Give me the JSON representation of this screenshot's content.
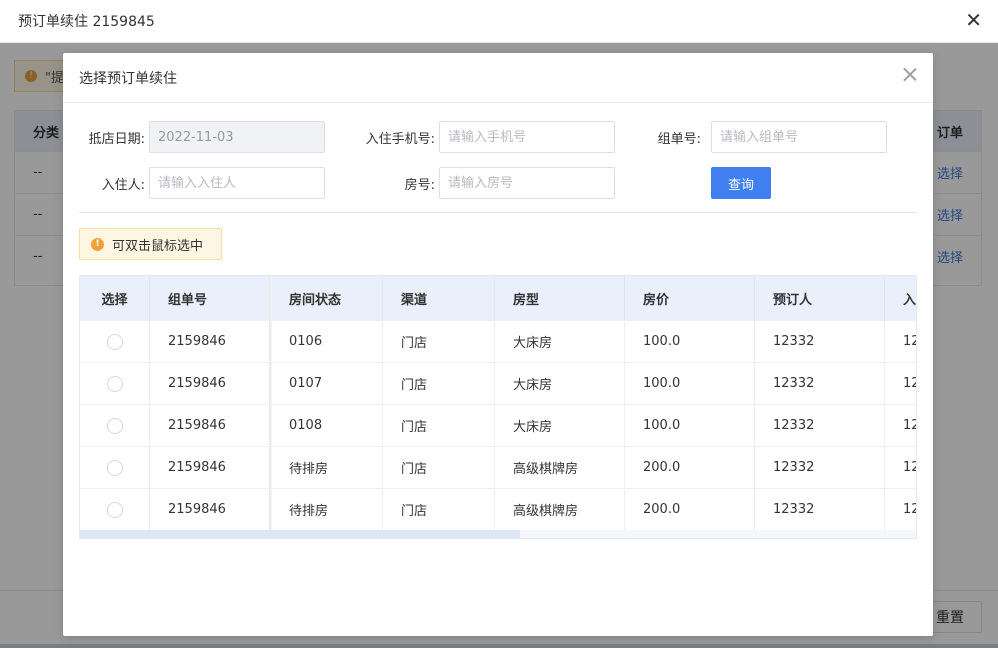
{
  "background": {
    "title": "预订单续住 2159845",
    "close_glyph": "✕",
    "alert_text": "\"提",
    "table_header_left": "分类",
    "table_header_right": "订单",
    "rows": [
      {
        "left": "--",
        "action": "选择"
      },
      {
        "left": "--",
        "action": "选择"
      },
      {
        "left": "--",
        "action": "选择"
      }
    ],
    "reset_label": "重置"
  },
  "modal": {
    "title": "选择预订单续住",
    "form": {
      "arrival_date_label": "抵店日期:",
      "arrival_date_value": "2022-11-03",
      "phone_label": "入住手机号:",
      "phone_placeholder": "请输入手机号",
      "group_no_label": "组单号:",
      "group_no_placeholder": "请输入组单号",
      "guest_label": "入住人:",
      "guest_placeholder": "请输入入住人",
      "room_label": "房号:",
      "room_placeholder": "请输入房号",
      "query_label": "查询"
    },
    "hint": {
      "icon_glyph": "!",
      "text": "可双击鼠标选中"
    },
    "table": {
      "columns": [
        "选择",
        "组单号",
        "房间状态",
        "渠道",
        "房型",
        "房价",
        "预订人",
        "入"
      ],
      "rows": [
        {
          "group_no": "2159846",
          "status": "0106",
          "channel": "门店",
          "room_type": "大床房",
          "price": "100.0",
          "booker": "12332",
          "extra": "12"
        },
        {
          "group_no": "2159846",
          "status": "0107",
          "channel": "门店",
          "room_type": "大床房",
          "price": "100.0",
          "booker": "12332",
          "extra": "12"
        },
        {
          "group_no": "2159846",
          "status": "0108",
          "channel": "门店",
          "room_type": "大床房",
          "price": "100.0",
          "booker": "12332",
          "extra": "12"
        },
        {
          "group_no": "2159846",
          "status": "待排房",
          "channel": "门店",
          "room_type": "高级棋牌房",
          "price": "200.0",
          "booker": "12332",
          "extra": "12"
        },
        {
          "group_no": "2159846",
          "status": "待排房",
          "channel": "门店",
          "room_type": "高级棋牌房",
          "price": "200.0",
          "booker": "12332",
          "extra": "12"
        }
      ]
    }
  },
  "colors": {
    "primary": "#3f7ff0",
    "warning": "#f0a23a",
    "table_header_bg": "#eaf0fb",
    "link": "#3a78d6"
  }
}
